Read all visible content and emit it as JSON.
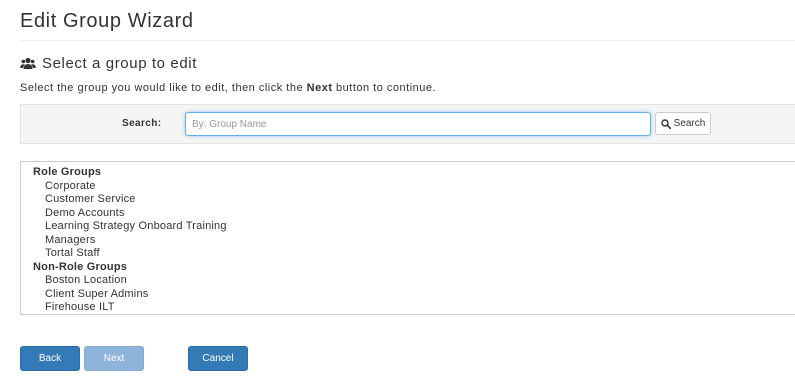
{
  "header": {
    "title": "Edit Group Wizard"
  },
  "section": {
    "icon": "users-icon",
    "title": "Select a group to edit"
  },
  "instructions": {
    "before": "Select the group you would like to edit, then click the ",
    "bold": "Next",
    "after": " button to continue."
  },
  "search": {
    "label": "Search:",
    "placeholder": "By: Group Name",
    "value": "",
    "button_label": "Search",
    "button_icon": "search-icon"
  },
  "groups": {
    "role_header": "Role Groups",
    "role_items": [
      "Corporate",
      "Customer Service",
      "Demo Accounts",
      "Learning Strategy Onboard Training",
      "Managers",
      "Tortal Staff"
    ],
    "nonrole_header": "Non-Role Groups",
    "nonrole_items": [
      "Boston Location",
      "Client Super Admins",
      "Firehouse ILT"
    ]
  },
  "buttons": {
    "back": "Back",
    "next": "Next",
    "cancel": "Cancel"
  },
  "colors": {
    "primary": "#337ab7",
    "primary_disabled": "#8fb4dc",
    "focus": "#66afe9",
    "panel_bg": "#f5f5f5"
  }
}
